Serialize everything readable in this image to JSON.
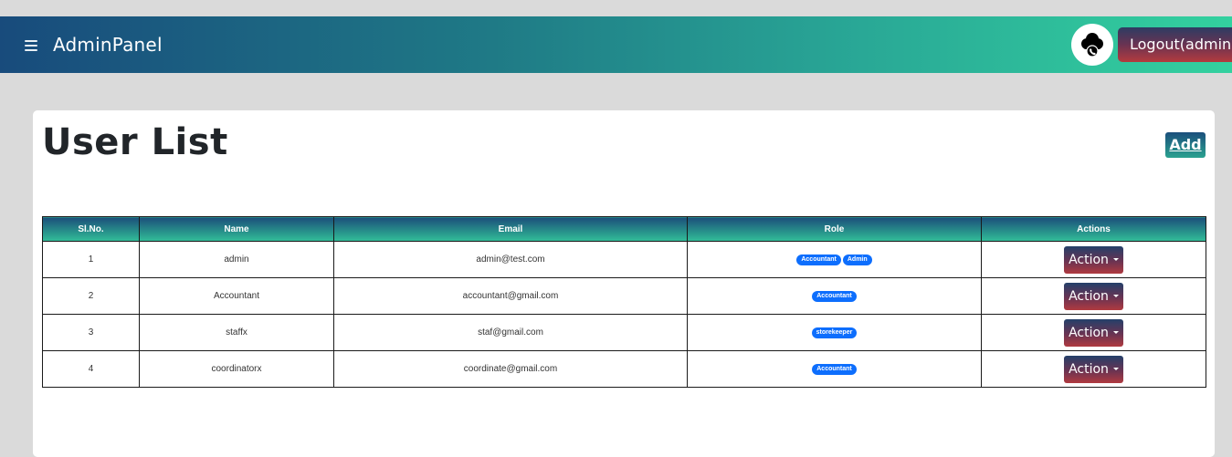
{
  "header": {
    "brand": "AdminPanel",
    "logout_label": "Logout(admin)",
    "gradient_colors": [
      "#184b7c",
      "#33d19f"
    ]
  },
  "main": {
    "title": "User List",
    "add_label": "Add",
    "table": {
      "columns": [
        "Sl.No.",
        "Name",
        "Email",
        "Role",
        "Actions"
      ],
      "action_label": "Action",
      "rows": [
        {
          "sl": "1",
          "name": "admin",
          "email": "admin@test.com",
          "roles": [
            "Accountant",
            "Admin"
          ]
        },
        {
          "sl": "2",
          "name": "Accountant",
          "email": "accountant@gmail.com",
          "roles": [
            "Accountant"
          ]
        },
        {
          "sl": "3",
          "name": "staffx",
          "email": "staf@gmail.com",
          "roles": [
            "storekeeper"
          ]
        },
        {
          "sl": "4",
          "name": "coordinatorx",
          "email": "coordinate@gmail.com",
          "roles": [
            "Accountant"
          ]
        }
      ]
    }
  },
  "icons": {
    "menu": "hamburger-icon",
    "avatar": "cloud-phone-icon",
    "caret": "caret-down-icon"
  },
  "colors": {
    "badge": "#0d6efd",
    "page_bg": "#dadada"
  }
}
